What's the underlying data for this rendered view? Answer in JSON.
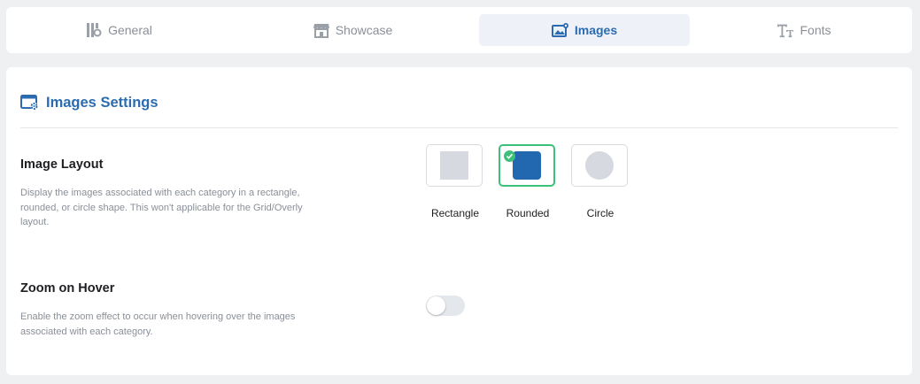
{
  "tabs": [
    {
      "label": "General",
      "icon": "general-settings-icon",
      "active": false
    },
    {
      "label": "Showcase",
      "icon": "storefront-icon",
      "active": false
    },
    {
      "label": "Images",
      "icon": "image-settings-icon",
      "active": true
    },
    {
      "label": "Fonts",
      "icon": "font-size-icon",
      "active": false
    }
  ],
  "section": {
    "title": "Images Settings",
    "icon": "window-settings-icon"
  },
  "image_layout": {
    "title": "Image Layout",
    "description": "Display the images associated with each category in a rectangle, rounded, or circle shape. This won't applicable for the Grid/Overly layout.",
    "options": [
      {
        "label": "Rectangle",
        "selected": false
      },
      {
        "label": "Rounded",
        "selected": true
      },
      {
        "label": "Circle",
        "selected": false
      }
    ]
  },
  "zoom_on_hover": {
    "title": "Zoom on Hover",
    "description": "Enable the zoom effect to occur when hovering over the images associated with each category.",
    "enabled": false
  },
  "colors": {
    "accent": "#2b6cb0",
    "selected_border": "#3cc07a",
    "shape_fill": "#d6d9df",
    "rounded_fill": "#2168b0"
  }
}
